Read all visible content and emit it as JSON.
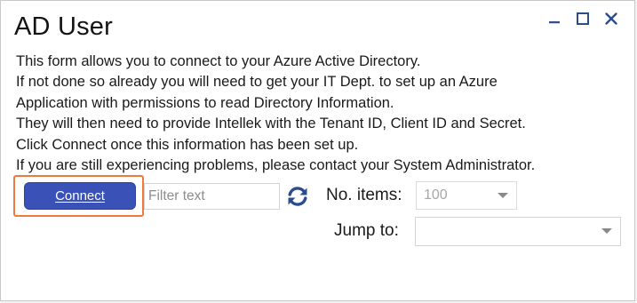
{
  "window": {
    "title": "AD User",
    "controls": [
      "minimize-icon",
      "maximize-icon",
      "close-icon"
    ]
  },
  "description": {
    "lines": [
      "This form allows you to connect to your Azure Active Directory.",
      "If not done so already you will need to get your IT Dept. to set up an Azure",
      "Application with permissions to read Directory Information.",
      "They will then need to provide Intellek with the Tenant ID, Client ID and Secret.",
      "Click Connect once this information has been set up.",
      "If you are still experiencing problems, please contact your System Administrator."
    ]
  },
  "toolbar": {
    "connect_label": "Connect",
    "filter_placeholder": "Filter text",
    "refresh_icon": "refresh-icon",
    "items_label": "No. items:",
    "items_value": "100",
    "jump_label": "Jump to:",
    "jump_value": ""
  },
  "colors": {
    "accent": "#3a51b8",
    "highlight": "#f07a3e",
    "icon": "#2b4c8f"
  }
}
